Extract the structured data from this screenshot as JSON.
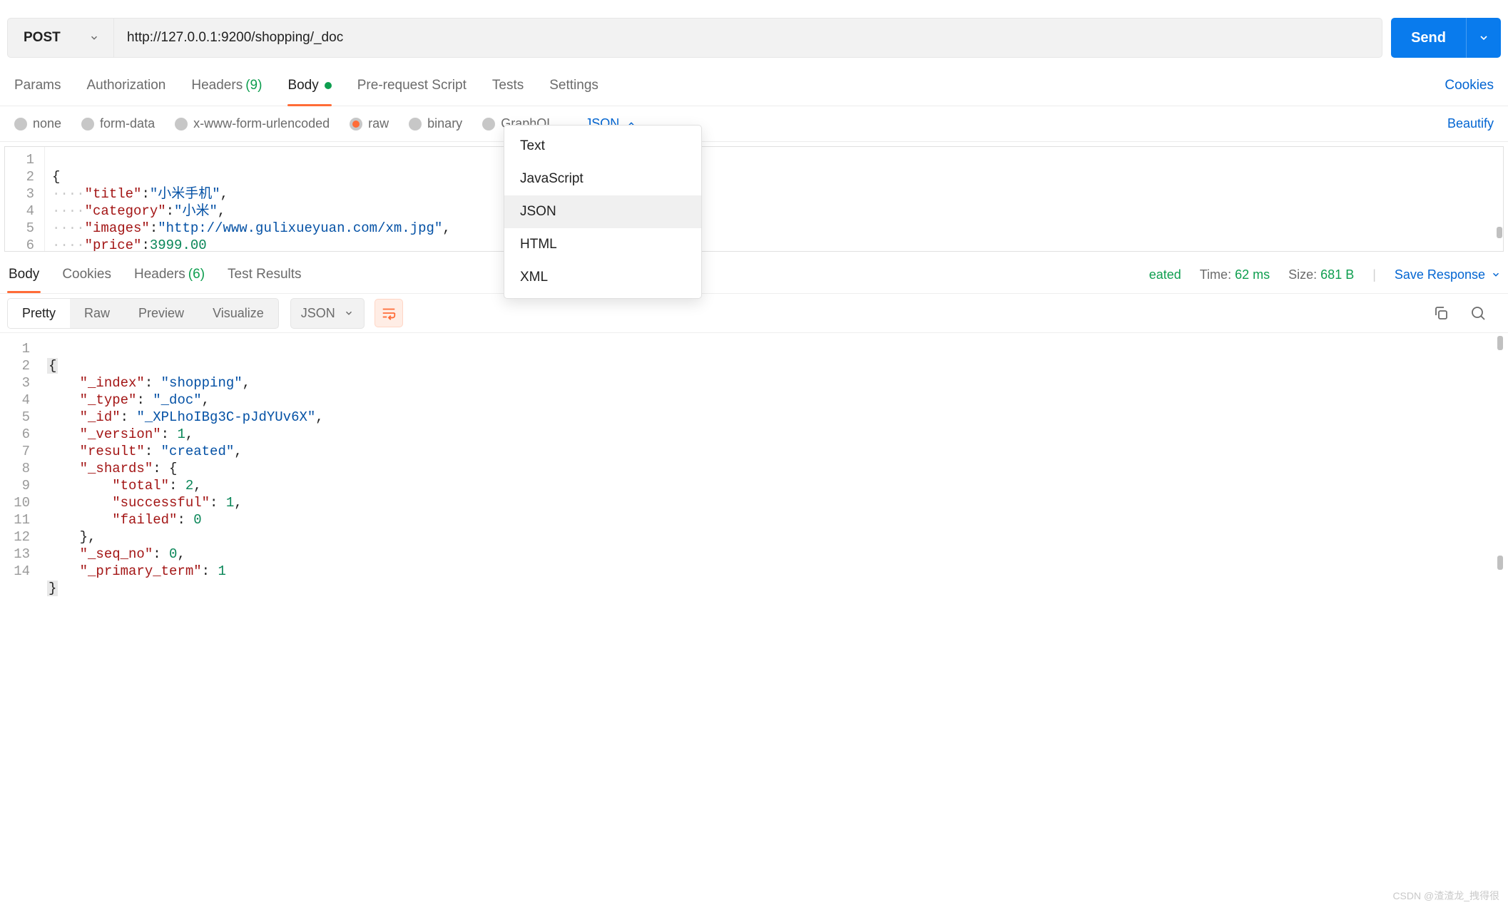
{
  "request": {
    "method": "POST",
    "url": "http://127.0.0.1:9200/shopping/_doc",
    "send_label": "Send"
  },
  "tabs": {
    "params": "Params",
    "authorization": "Authorization",
    "headers": "Headers",
    "headers_count": "(9)",
    "body": "Body",
    "prerequest": "Pre-request Script",
    "tests": "Tests",
    "settings": "Settings",
    "cookies": "Cookies"
  },
  "body_types": {
    "none": "none",
    "formdata": "form-data",
    "xwww": "x-www-form-urlencoded",
    "raw": "raw",
    "binary": "binary",
    "graphql": "GraphQL",
    "content_sel": "JSON",
    "beautify": "Beautify"
  },
  "content_type_options": {
    "text": "Text",
    "javascript": "JavaScript",
    "json": "JSON",
    "html": "HTML",
    "xml": "XML"
  },
  "request_body_lines": [
    "1",
    "2",
    "3",
    "4",
    "5",
    "6"
  ],
  "request_body": {
    "title_key": "\"title\"",
    "title_val": "\"小米手机\"",
    "category_key": "\"category\"",
    "category_val": "\"小米\"",
    "images_key": "\"images\"",
    "images_val": "\"http://www.gulixueyuan.com/xm.jpg\"",
    "price_key": "\"price\"",
    "price_val": "3999.00"
  },
  "response": {
    "tabs": {
      "body": "Body",
      "cookies": "Cookies",
      "headers": "Headers",
      "headers_count": "(6)",
      "test_results": "Test Results"
    },
    "status_partial": "eated",
    "time_label": "Time:",
    "time_val": "62 ms",
    "size_label": "Size:",
    "size_val": "681 B",
    "save": "Save Response",
    "view": {
      "pretty": "Pretty",
      "raw": "Raw",
      "preview": "Preview",
      "visualize": "Visualize"
    },
    "format": "JSON",
    "lines": [
      "1",
      "2",
      "3",
      "4",
      "5",
      "6",
      "7",
      "8",
      "9",
      "10",
      "11",
      "12",
      "13",
      "14"
    ],
    "json": {
      "index_k": "\"_index\"",
      "index_v": "\"shopping\"",
      "type_k": "\"_type\"",
      "type_v": "\"_doc\"",
      "id_k": "\"_id\"",
      "id_v": "\"_XPLhoIBg3C-pJdYUv6X\"",
      "version_k": "\"_version\"",
      "version_v": "1",
      "result_k": "\"result\"",
      "result_v": "\"created\"",
      "shards_k": "\"_shards\"",
      "total_k": "\"total\"",
      "total_v": "2",
      "successful_k": "\"successful\"",
      "successful_v": "1",
      "failed_k": "\"failed\"",
      "failed_v": "0",
      "seqno_k": "\"_seq_no\"",
      "seqno_v": "0",
      "primary_k": "\"_primary_term\"",
      "primary_v": "1"
    }
  },
  "watermark": "CSDN @渣渣龙_拽得很"
}
